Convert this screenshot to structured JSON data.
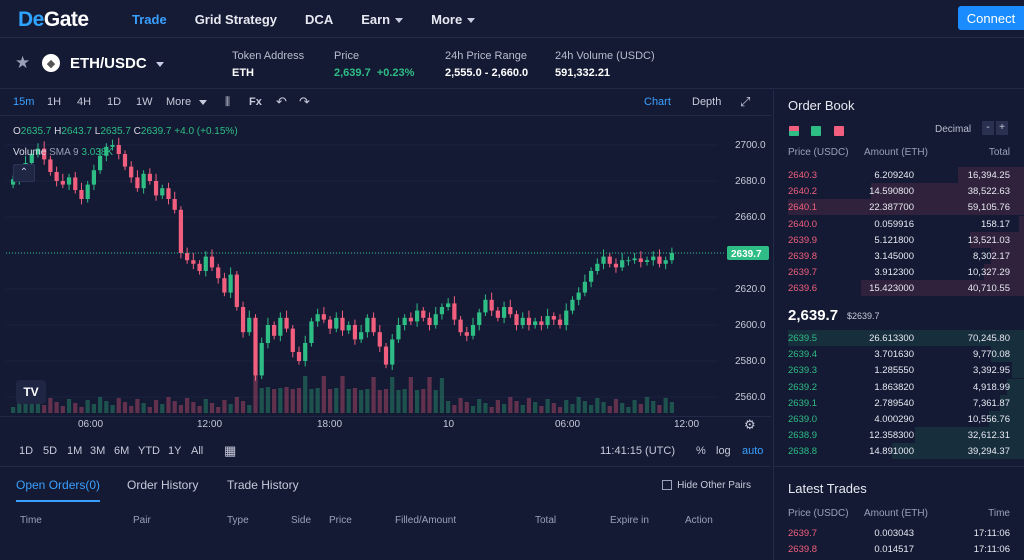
{
  "logo": {
    "prefix": "De",
    "suffix": "Gate"
  },
  "nav": {
    "trade": "Trade",
    "grid": "Grid Strategy",
    "dca": "DCA",
    "earn": "Earn",
    "more": "More",
    "connect": "Connect"
  },
  "pair": {
    "name": "ETH/USDC",
    "token_address_label": "Token Address",
    "token_address_value": "ETH",
    "price_label": "Price",
    "price_value": "2,639.7",
    "price_change": "+0.23%",
    "range_label": "24h Price Range",
    "range_value": "2,555.0 - 2,660.0",
    "volume_label": "24h Volume (USDC)",
    "volume_value": "591,332.21"
  },
  "toolbar": {
    "i15m": "15m",
    "i1h": "1H",
    "i4h": "4H",
    "i1d": "1D",
    "i1w": "1W",
    "more": "More",
    "fx": "Fx",
    "chart": "Chart",
    "depth": "Depth"
  },
  "legend": {
    "o": "2635.7",
    "h": "2643.7",
    "l": "2635.7",
    "c": "2639.7",
    "chg": "+4.0 (+0.15%)",
    "volume_label": "Volume",
    "sma": "SMA 9",
    "sma_value": "3.038K"
  },
  "price_ticks": [
    "2700.0",
    "2680.0",
    "2660.0",
    "2640.0",
    "2620.0",
    "2600.0",
    "2580.0",
    "2560.0"
  ],
  "last_price_tag": "2639.7",
  "time_ticks": [
    "06:00",
    "12:00",
    "18:00",
    "10",
    "06:00",
    "12:00"
  ],
  "ranges": {
    "r1d": "1D",
    "r5d": "5D",
    "r1m": "1M",
    "r3m": "3M",
    "r6m": "6M",
    "ytd": "YTD",
    "r1y": "1Y",
    "all": "All",
    "clock": "11:41:15 (UTC)",
    "pct": "%",
    "log": "log",
    "auto": "auto"
  },
  "orders": {
    "tab_open": "Open Orders(0)",
    "tab_history": "Order History",
    "tab_trades": "Trade History",
    "hide_other": "Hide Other Pairs",
    "cols": {
      "time": "Time",
      "pair": "Pair",
      "type": "Type",
      "side": "Side",
      "price": "Price",
      "filled": "Filled/Amount",
      "total": "Total",
      "expire": "Expire in",
      "action": "Action"
    }
  },
  "orderbook": {
    "title": "Order Book",
    "decimal": "Decimal",
    "hdr_price": "Price (USDC)",
    "hdr_amount": "Amount (ETH)",
    "hdr_total": "Total",
    "asks": [
      {
        "price": "2640.3",
        "amount": "6.209240",
        "total": "16,394.25",
        "depth": 0.28
      },
      {
        "price": "2640.2",
        "amount": "14.590800",
        "total": "38,522.63",
        "depth": 0.65
      },
      {
        "price": "2640.1",
        "amount": "22.387700",
        "total": "59,105.76",
        "depth": 1.0
      },
      {
        "price": "2640.0",
        "amount": "0.059916",
        "total": "158.17",
        "depth": 0.02
      },
      {
        "price": "2639.9",
        "amount": "5.121800",
        "total": "13,521.03",
        "depth": 0.23
      },
      {
        "price": "2639.8",
        "amount": "3.145000",
        "total": "8,302.17",
        "depth": 0.14
      },
      {
        "price": "2639.7",
        "amount": "3.912300",
        "total": "10,327.29",
        "depth": 0.17
      },
      {
        "price": "2639.6",
        "amount": "15.423000",
        "total": "40,710.55",
        "depth": 0.69
      }
    ],
    "mid_price": "2,639.7",
    "mid_usd": "$2639.7",
    "bids": [
      {
        "price": "2639.5",
        "amount": "26.613300",
        "total": "70,245.80",
        "depth": 1.0
      },
      {
        "price": "2639.4",
        "amount": "3.701630",
        "total": "9,770.08",
        "depth": 0.14
      },
      {
        "price": "2639.3",
        "amount": "1.285550",
        "total": "3,392.95",
        "depth": 0.05
      },
      {
        "price": "2639.2",
        "amount": "1.863820",
        "total": "4,918.99",
        "depth": 0.07
      },
      {
        "price": "2639.1",
        "amount": "2.789540",
        "total": "7,361.87",
        "depth": 0.1
      },
      {
        "price": "2639.0",
        "amount": "4.000290",
        "total": "10,556.76",
        "depth": 0.15
      },
      {
        "price": "2638.9",
        "amount": "12.358300",
        "total": "32,612.31",
        "depth": 0.46
      },
      {
        "price": "2638.8",
        "amount": "14.891000",
        "total": "39,294.37",
        "depth": 0.56
      }
    ]
  },
  "latest_trades": {
    "title": "Latest Trades",
    "hdr_price": "Price (USDC)",
    "hdr_amount": "Amount (ETH)",
    "hdr_time": "Time",
    "rows": [
      {
        "price": "2639.7",
        "amount": "0.003043",
        "time": "17:11:06"
      },
      {
        "price": "2639.8",
        "amount": "0.014517",
        "time": "17:11:06"
      }
    ]
  },
  "chart_data": {
    "type": "candlestick",
    "ylim": [
      2550,
      2710
    ],
    "closes": [
      2681,
      2684,
      2690,
      2695,
      2698,
      2692,
      2685,
      2680,
      2678,
      2682,
      2675,
      2670,
      2678,
      2686,
      2694,
      2699,
      2700,
      2695,
      2688,
      2682,
      2676,
      2684,
      2680,
      2672,
      2676,
      2670,
      2664,
      2640,
      2636,
      2634,
      2630,
      2638,
      2632,
      2626,
      2618,
      2628,
      2610,
      2596,
      2604,
      2572,
      2590,
      2600,
      2594,
      2604,
      2598,
      2585,
      2580,
      2590,
      2602,
      2606,
      2603,
      2598,
      2604,
      2597,
      2600,
      2592,
      2596,
      2604,
      2596,
      2588,
      2578,
      2592,
      2600,
      2604,
      2602,
      2608,
      2604,
      2600,
      2606,
      2610,
      2612,
      2603,
      2596,
      2594,
      2600,
      2607,
      2614,
      2608,
      2604,
      2610,
      2606,
      2600,
      2604,
      2600,
      2602,
      2600,
      2605,
      2603,
      2600,
      2608,
      2614,
      2618,
      2624,
      2630,
      2634,
      2638,
      2634,
      2632,
      2636,
      2636,
      2637,
      2635,
      2636,
      2638,
      2634,
      2636,
      2640
    ],
    "volume_ticks_hint": "volume bars bottom"
  }
}
